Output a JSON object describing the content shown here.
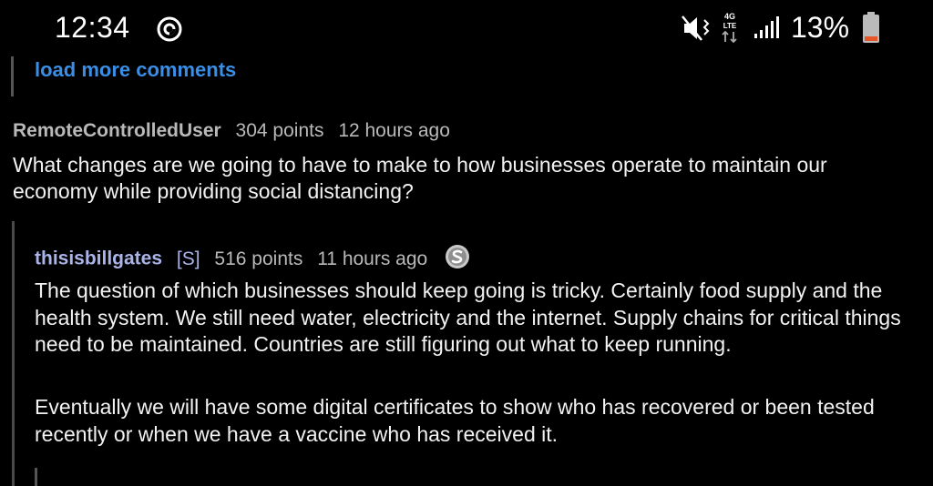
{
  "status_bar": {
    "time": "12:34",
    "battery_percent": "13%",
    "network_label": "4G LTE",
    "icons": [
      "sync-icon",
      "mute-icon",
      "network-4g-lte-icon",
      "signal-icon",
      "battery-low-icon"
    ],
    "battery_color": "#e8572a"
  },
  "thread": {
    "load_more_label": "load more comments",
    "comments": [
      {
        "author": "RemoteControlledUser",
        "points": "304 points",
        "time": "12 hours ago",
        "body": "What changes are we going to have to make to how businesses operate to maintain our economy while providing social distancing?"
      },
      {
        "author": "thisisbillgates",
        "tag": "[S]",
        "points": "516 points",
        "time": "11 hours ago",
        "badge_icon": "silver-award-icon",
        "paragraphs": [
          "The question of which businesses should keep going is tricky. Certainly food supply and the health system. We still need water, electricity and the internet. Supply chains for critical things need to be maintained. Countries are still figuring out what to keep running.",
          "Eventually we will have some digital certificates to show who has recovered or been tested recently or when we have a vaccine who has received it."
        ]
      }
    ]
  },
  "colors": {
    "background": "#000000",
    "link": "#3a8ee6",
    "submitter": "#aab4e8",
    "meta": "#b9b9b9",
    "body_text": "#f2f2f2"
  }
}
